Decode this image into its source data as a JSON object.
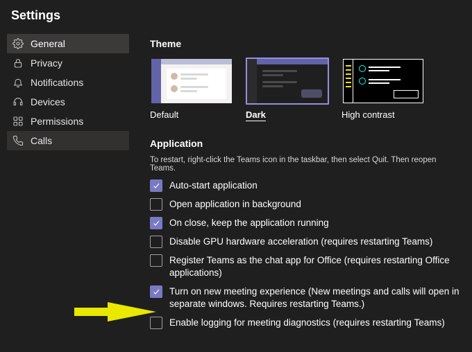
{
  "title": "Settings",
  "sidebar": {
    "items": [
      {
        "label": "General",
        "icon": "gear-icon"
      },
      {
        "label": "Privacy",
        "icon": "lock-icon"
      },
      {
        "label": "Notifications",
        "icon": "bell-icon"
      },
      {
        "label": "Devices",
        "icon": "headset-icon"
      },
      {
        "label": "Permissions",
        "icon": "apps-icon"
      },
      {
        "label": "Calls",
        "icon": "phone-icon"
      }
    ],
    "active_index": 0,
    "hover_index": 5
  },
  "theme": {
    "section_title": "Theme",
    "options": [
      {
        "key": "default",
        "label": "Default"
      },
      {
        "key": "dark",
        "label": "Dark"
      },
      {
        "key": "contrast",
        "label": "High contrast"
      }
    ],
    "selected": "dark"
  },
  "application": {
    "section_title": "Application",
    "hint": "To restart, right-click the Teams icon in the taskbar, then select Quit. Then reopen Teams.",
    "options": [
      {
        "label": "Auto-start application",
        "checked": true
      },
      {
        "label": "Open application in background",
        "checked": false
      },
      {
        "label": "On close, keep the application running",
        "checked": true
      },
      {
        "label": "Disable GPU hardware acceleration (requires restarting Teams)",
        "checked": false
      },
      {
        "label": "Register Teams as the chat app for Office (requires restarting Office applications)",
        "checked": false
      },
      {
        "label": "Turn on new meeting experience (New meetings and calls will open in separate windows. Requires restarting Teams.)",
        "checked": true
      },
      {
        "label": "Enable logging for meeting diagnostics (requires restarting Teams)",
        "checked": false
      }
    ]
  },
  "annotation": {
    "arrow_color": "#e8e800"
  }
}
